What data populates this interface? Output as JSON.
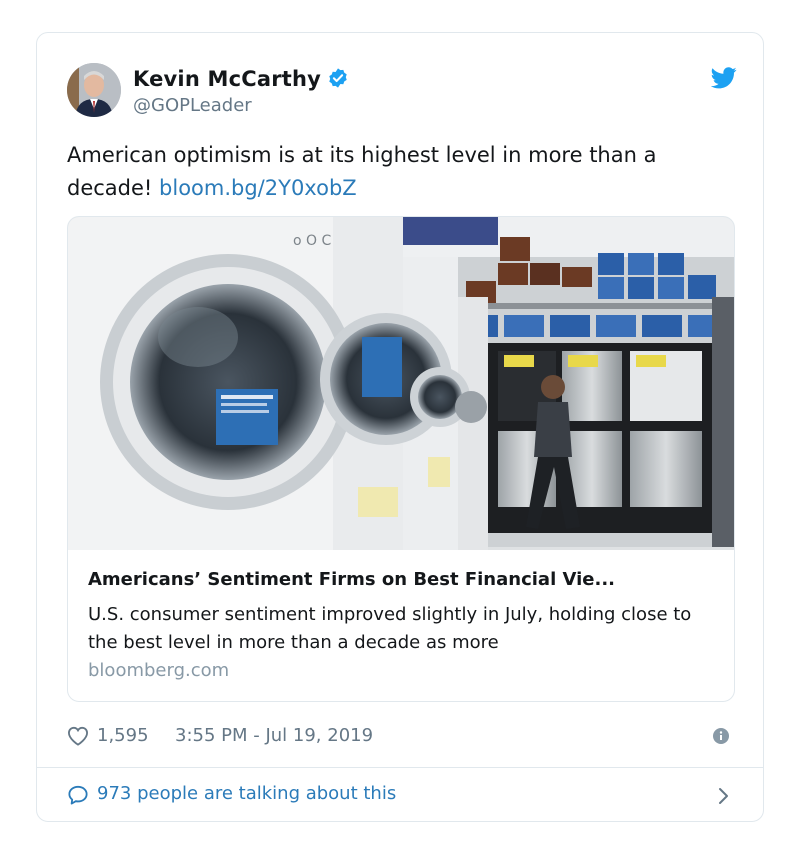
{
  "tweet": {
    "author_name": "Kevin McCarthy",
    "author_handle": "@GOPLeader",
    "text": "American optimism is at its highest level in more than a decade!",
    "link": "bloom.bg/2Y0xobZ",
    "likes": "1,595",
    "timestamp": "3:55 PM - Jul 19, 2019",
    "talking": "973 people are talking about this"
  },
  "card": {
    "title": "Americans’ Sentiment Firms on Best Financial Vie...",
    "description": "U.S. consumer sentiment improved slightly in July, holding close to the best level in more than a decade as more",
    "domain": "bloomberg.com"
  },
  "icons": {
    "verified": "verified-badge-icon",
    "brand": "twitter-bird-icon",
    "like": "heart-icon",
    "info": "info-icon",
    "reply": "speech-bubble-icon",
    "chevron": "chevron-right-icon"
  },
  "colors": {
    "link": "#2b7bb9",
    "twitter_blue": "#1da1f2",
    "secondary_text": "#657786",
    "border": "#e1e8ed"
  }
}
